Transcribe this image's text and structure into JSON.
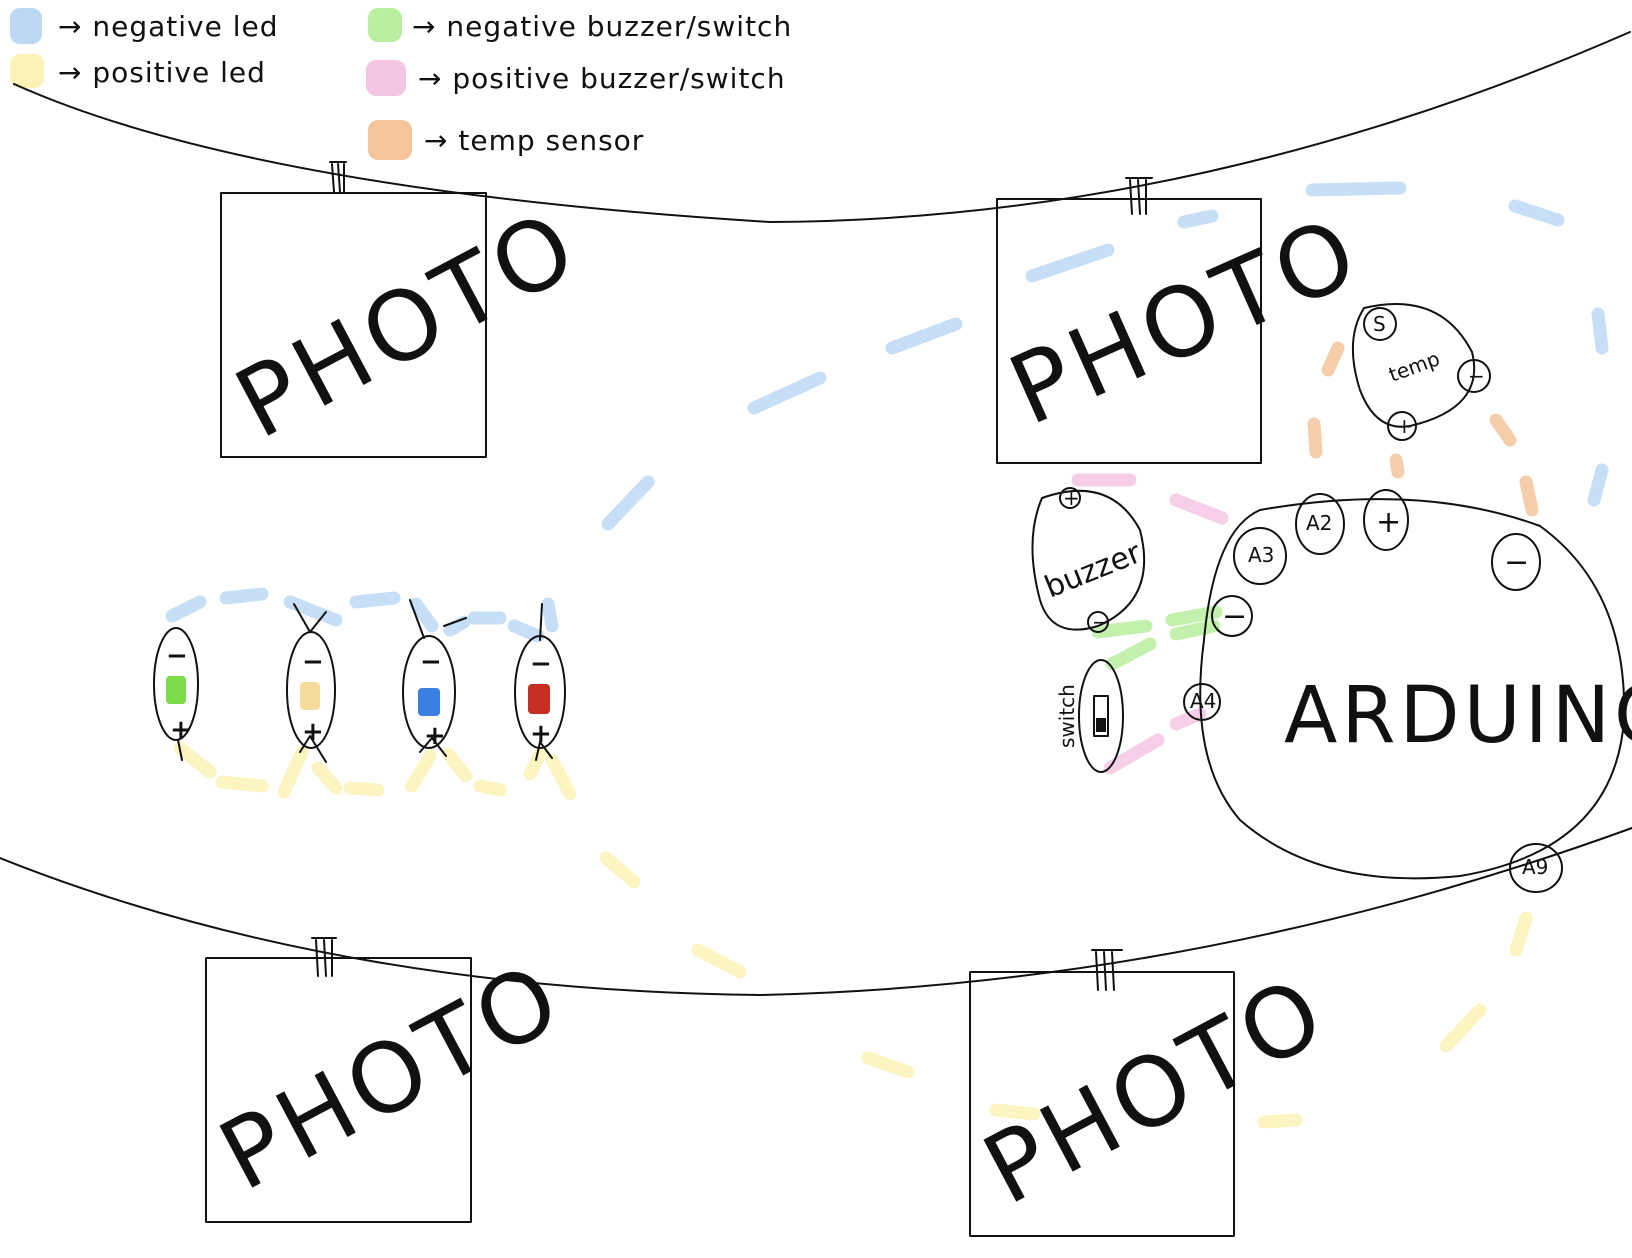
{
  "legend": [
    {
      "label": "→ negative led",
      "color": "#bcd8f4"
    },
    {
      "label": "→ positive led",
      "color": "#fbf2b6"
    },
    {
      "label": "→ negative buzzer/switch",
      "color": "#b9ef9f"
    },
    {
      "label": "→ positive buzzer/switch",
      "color": "#f5c6e4"
    },
    {
      "label": "→ temp sensor",
      "color": "#f5c49b"
    }
  ],
  "photos": [
    {
      "label": "PHOTO"
    },
    {
      "label": "PHOTO"
    },
    {
      "label": "PHOTO"
    },
    {
      "label": "PHOTO"
    }
  ],
  "leds": [
    {
      "color": "#7ddc4a",
      "neg": "−",
      "pos": "+"
    },
    {
      "color": "#f6dc9c",
      "neg": "−",
      "pos": "+"
    },
    {
      "color": "#3b7fe0",
      "neg": "−",
      "pos": "+"
    },
    {
      "color": "#c62e22",
      "neg": "−",
      "pos": "+"
    }
  ],
  "arduino": {
    "label": "ARDUINO",
    "pins": {
      "a3": "A3",
      "a2": "A2",
      "plus": "+",
      "minus": "−",
      "a4": "A4",
      "a9": "A9",
      "ground": "−"
    }
  },
  "buzzer": {
    "label": "buzzer",
    "plus": "+",
    "minus": "−"
  },
  "switch": {
    "label": "switch"
  },
  "temp": {
    "label": "temp",
    "s": "S",
    "minus": "−",
    "plus": "+"
  }
}
